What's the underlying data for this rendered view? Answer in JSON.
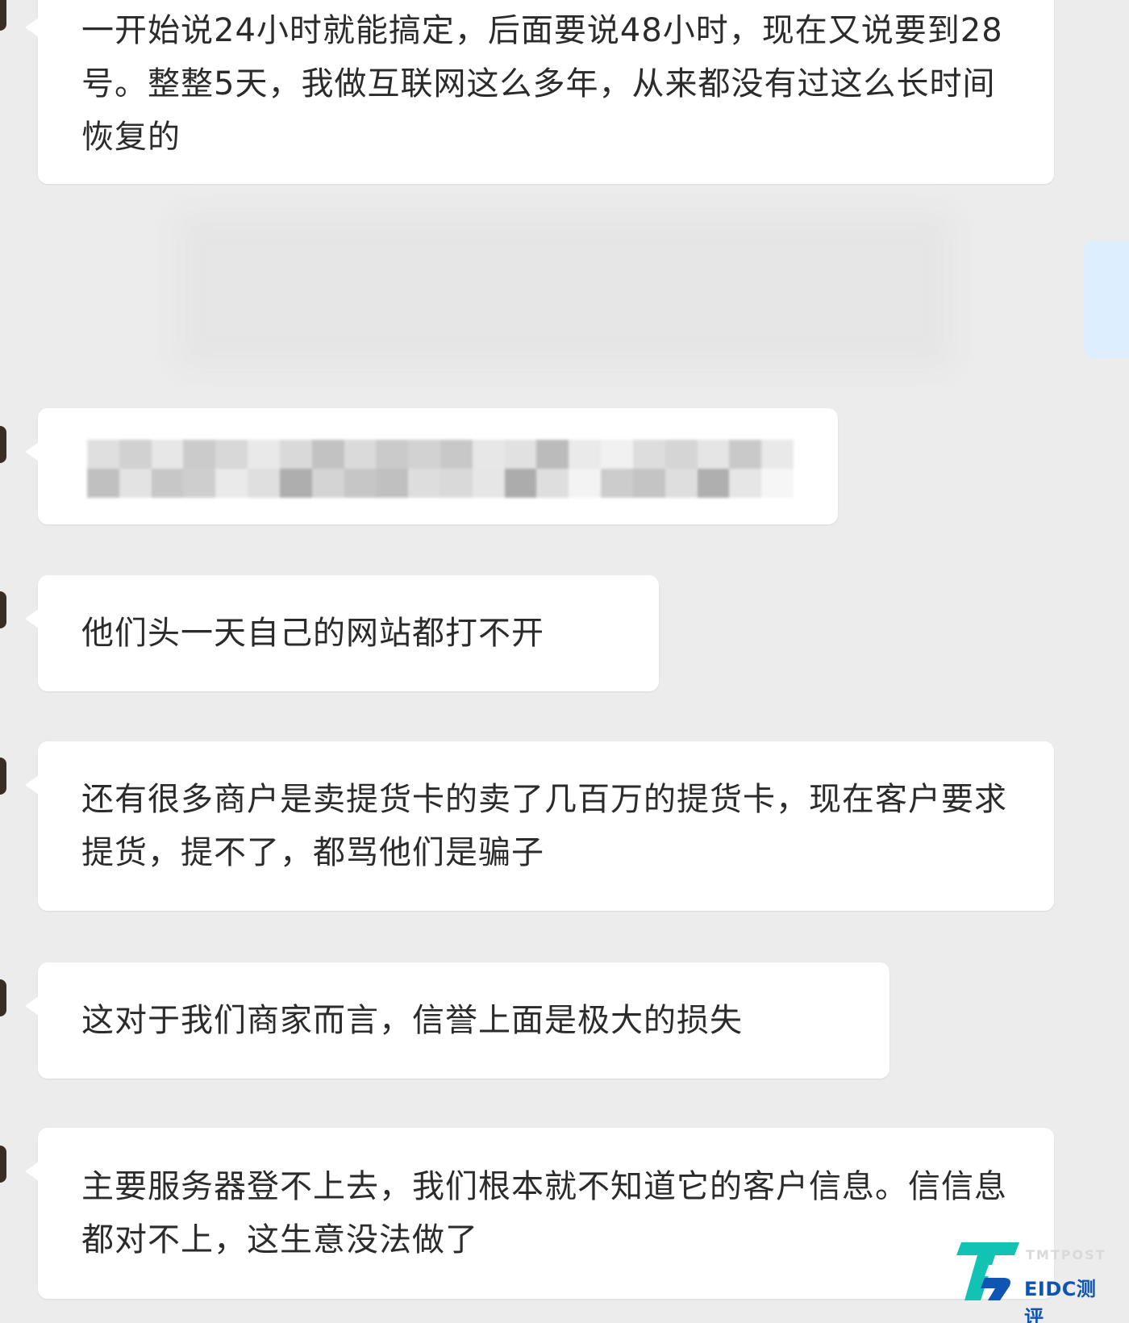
{
  "chat": {
    "messages": [
      {
        "sender": "other",
        "text": "一开始说24小时就能搞定，后面要说48小时，现在又说要到28号。整整5天，我做互联网这么多年，从来都没有过这么长时间恢复的"
      },
      {
        "sender": "self",
        "text": ""
      },
      {
        "sender": "other",
        "text": ""
      },
      {
        "sender": "other",
        "text": "他们头一天自己的网站都打不开"
      },
      {
        "sender": "other",
        "text": "还有很多商户是卖提货卡的卖了几百万的提货卡，现在客户要求提货，提不了，都骂他们是骗子"
      },
      {
        "sender": "other",
        "text": "这对于我们商家而言，信誉上面是极大的损失"
      },
      {
        "sender": "other",
        "text": "主要服务器登不上去，我们根本就不知道它的客户信息。信信息都对不上，这生意没法做了"
      }
    ]
  },
  "watermark": {
    "top_text": "TMTPOST",
    "brand_text": "EIDC测评",
    "mark_icon": "tt-logo-icon"
  },
  "colors": {
    "background": "#ececec",
    "bubble_other": "#ffffff",
    "bubble_self": "#dceeff",
    "text": "#2b2b2b",
    "watermark_teal": "#12c2b3",
    "watermark_blue": "#0f55b2"
  }
}
